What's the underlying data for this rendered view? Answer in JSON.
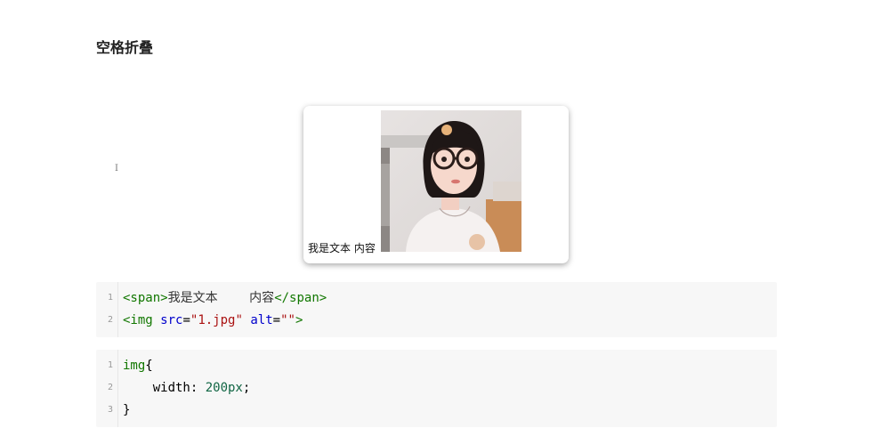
{
  "heading": "空格折叠",
  "cursor_glyph": "I",
  "demo": {
    "text": "我是文本 内容"
  },
  "html_code": {
    "lines": [
      {
        "no": "1",
        "tokens": [
          {
            "t": "<span>",
            "c": "tag"
          },
          {
            "t": "我是文本        内容",
            "c": "text"
          },
          {
            "t": "</span>",
            "c": "tag"
          }
        ]
      },
      {
        "no": "2",
        "tokens": [
          {
            "t": "<img",
            "c": "tag"
          },
          {
            "t": " ",
            "c": "plain"
          },
          {
            "t": "src",
            "c": "attr"
          },
          {
            "t": "=",
            "c": "plain"
          },
          {
            "t": "\"1.jpg\"",
            "c": "str"
          },
          {
            "t": " ",
            "c": "plain"
          },
          {
            "t": "alt",
            "c": "attr"
          },
          {
            "t": "=",
            "c": "plain"
          },
          {
            "t": "\"\"",
            "c": "str"
          },
          {
            "t": ">",
            "c": "tag"
          }
        ]
      }
    ]
  },
  "css_code": {
    "lines": [
      {
        "no": "1",
        "tokens": [
          {
            "t": "img",
            "c": "tag"
          },
          {
            "t": "{",
            "c": "plain"
          }
        ]
      },
      {
        "no": "2",
        "tokens": [
          {
            "t": "    width: ",
            "c": "prop"
          },
          {
            "t": "200px",
            "c": "num"
          },
          {
            "t": ";",
            "c": "plain"
          }
        ]
      },
      {
        "no": "3",
        "tokens": [
          {
            "t": "}",
            "c": "plain"
          }
        ]
      }
    ]
  }
}
